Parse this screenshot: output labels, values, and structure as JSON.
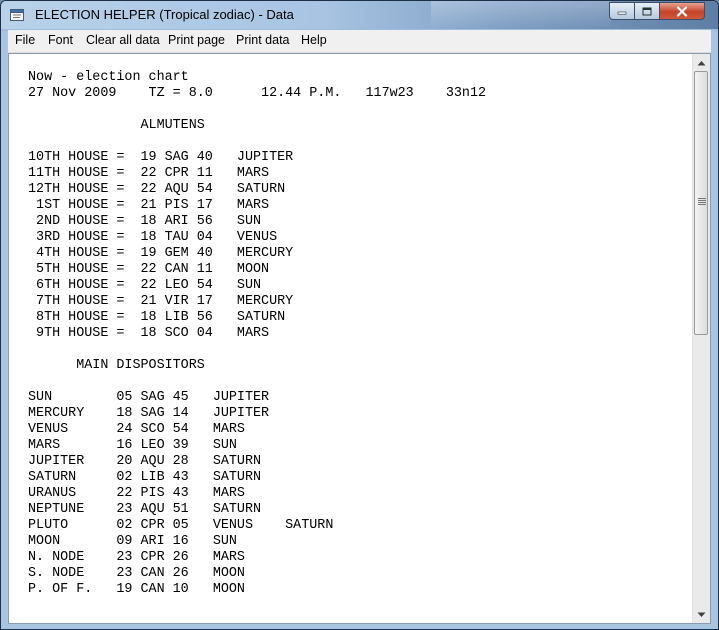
{
  "window": {
    "title": "ELECTION HELPER (Tropical zodiac) - Data"
  },
  "menu": {
    "items": [
      "File",
      "Font",
      "Clear all data",
      "Print page",
      "Print data",
      "Help"
    ]
  },
  "content": {
    "lines": [
      "Now - election chart",
      "27 Nov 2009    TZ = 8.0      12.44 P.M.   117w23    33n12",
      "",
      "              ALMUTENS",
      "",
      "10TH HOUSE =  19 SAG 40   JUPITER",
      "11TH HOUSE =  22 CPR 11   MARS",
      "12TH HOUSE =  22 AQU 54   SATURN",
      " 1ST HOUSE =  21 PIS 17   MARS",
      " 2ND HOUSE =  18 ARI 56   SUN",
      " 3RD HOUSE =  18 TAU 04   VENUS",
      " 4TH HOUSE =  19 GEM 40   MERCURY",
      " 5TH HOUSE =  22 CAN 11   MOON",
      " 6TH HOUSE =  22 LEO 54   SUN",
      " 7TH HOUSE =  21 VIR 17   MERCURY",
      " 8TH HOUSE =  18 LIB 56   SATURN",
      " 9TH HOUSE =  18 SCO 04   MARS",
      "",
      "      MAIN DISPOSITORS",
      "",
      "SUN        05 SAG 45   JUPITER",
      "MERCURY    18 SAG 14   JUPITER",
      "VENUS      24 SCO 54   MARS",
      "MARS       16 LEO 39   SUN",
      "JUPITER    20 AQU 28   SATURN",
      "SATURN     02 LIB 43   SATURN",
      "URANUS     22 PIS 43   MARS",
      "NEPTUNE    23 AQU 51   SATURN",
      "PLUTO      02 CPR 05   VENUS    SATURN",
      "MOON       09 ARI 16   SUN",
      "N. NODE    23 CPR 26   MARS",
      "S. NODE    23 CAN 26   MOON",
      "P. OF F.   19 CAN 10   MOON"
    ]
  }
}
